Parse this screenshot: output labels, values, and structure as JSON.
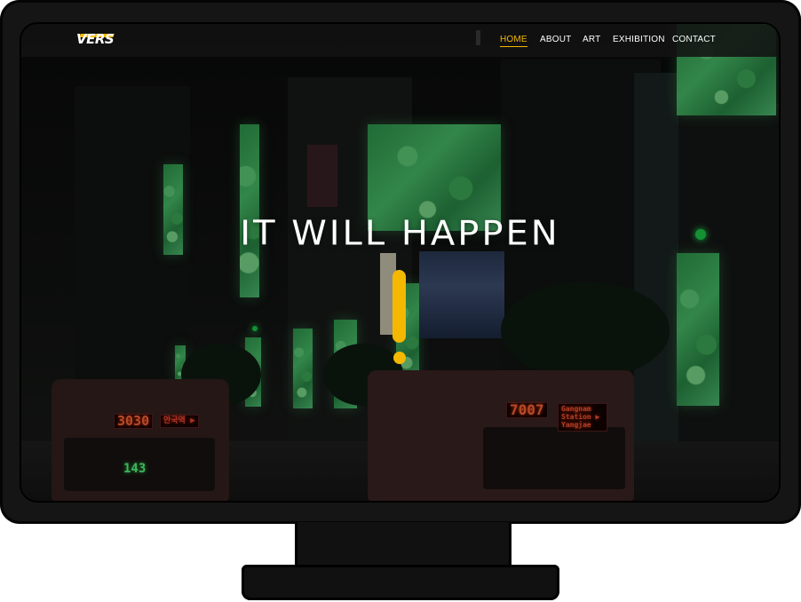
{
  "site": {
    "logo_text": "VERS"
  },
  "nav": {
    "items": [
      {
        "label": "HOME",
        "active": true
      },
      {
        "label": "ABOUT",
        "active": false
      },
      {
        "label": "ART",
        "active": false
      },
      {
        "label": "EXHIBITION",
        "active": false
      },
      {
        "label": "CONTACT",
        "active": false
      }
    ]
  },
  "hero": {
    "headline": "IT WILL HAPPEN",
    "accent_icon": "exclamation-mark-icon"
  },
  "scene": {
    "bus_left_number": "3030",
    "bus_left_destination": "안국역 ▶",
    "bus_left_route": "143",
    "bus_right_number": "7007",
    "bus_right_destination": "Gangnam Station ▶ Yangjae"
  },
  "colors": {
    "accent": "#f5b800",
    "nav_text": "#ffffff",
    "navbar_bg": "#121212",
    "monitor_frame": "#151515"
  }
}
